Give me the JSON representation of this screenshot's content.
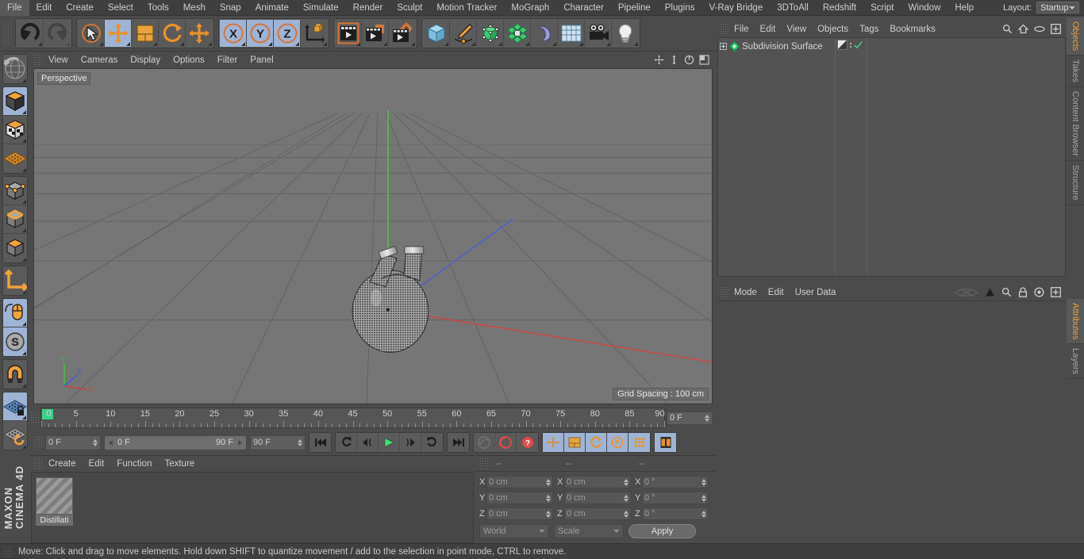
{
  "app": {
    "title": "CINEMA 4D",
    "brand_top": "MAXON",
    "brand_bottom": "CINEMA 4D"
  },
  "menubar": {
    "items": [
      {
        "label": "File"
      },
      {
        "label": "Edit"
      },
      {
        "label": "Create"
      },
      {
        "label": "Select"
      },
      {
        "label": "Tools"
      },
      {
        "label": "Mesh"
      },
      {
        "label": "Snap"
      },
      {
        "label": "Animate"
      },
      {
        "label": "Simulate"
      },
      {
        "label": "Render"
      },
      {
        "label": "Sculpt"
      },
      {
        "label": "Motion Tracker"
      },
      {
        "label": "MoGraph"
      },
      {
        "label": "Character"
      },
      {
        "label": "Pipeline"
      },
      {
        "label": "Plugins"
      },
      {
        "label": "V-Ray Bridge"
      },
      {
        "label": "3DToAll"
      },
      {
        "label": "Redshift"
      },
      {
        "label": "Script"
      },
      {
        "label": "Window"
      },
      {
        "label": "Help"
      }
    ],
    "layout_label": "Layout:",
    "layout_value": "Startup"
  },
  "toolbar": {
    "groups": [
      {
        "name": "history",
        "buttons": [
          {
            "icon": "undo-icon",
            "label": "Undo",
            "active": false,
            "disabled": false
          },
          {
            "icon": "redo-icon",
            "label": "Redo",
            "active": false,
            "disabled": true
          }
        ]
      },
      {
        "name": "transform",
        "buttons": [
          {
            "icon": "select-cursor-icon",
            "label": "Live Selection",
            "active": false,
            "disabled": false
          },
          {
            "icon": "move-icon",
            "label": "Move",
            "active": true,
            "disabled": false
          },
          {
            "icon": "scale-icon",
            "label": "Scale",
            "active": false,
            "disabled": false
          },
          {
            "icon": "rotate-icon",
            "label": "Rotate",
            "active": false,
            "disabled": false
          },
          {
            "icon": "move-alt-icon",
            "label": "Move (duplicate)",
            "active": false,
            "disabled": false
          }
        ]
      },
      {
        "name": "axis-lock",
        "buttons": [
          {
            "icon": "axis-x-icon",
            "label": "X Axis",
            "active": true,
            "disabled": false
          },
          {
            "icon": "axis-y-icon",
            "label": "Y Axis",
            "active": true,
            "disabled": false
          },
          {
            "icon": "axis-z-icon",
            "label": "Z Axis",
            "active": true,
            "disabled": false
          },
          {
            "icon": "world-coordinates-icon",
            "label": "World/Object Coordinates",
            "active": false,
            "disabled": false
          }
        ]
      },
      {
        "name": "render",
        "buttons": [
          {
            "icon": "render-view-icon",
            "label": "Render View",
            "active": false,
            "disabled": false
          },
          {
            "icon": "render-to-picture-viewer-icon",
            "label": "Render to Picture Viewer",
            "active": false,
            "disabled": false
          },
          {
            "icon": "render-settings-icon",
            "label": "Edit Render Settings",
            "active": false,
            "disabled": false
          }
        ]
      },
      {
        "name": "create",
        "buttons": [
          {
            "icon": "cube-primitive-icon",
            "label": "Add Cube Object",
            "active": false,
            "disabled": false
          },
          {
            "icon": "spline-pen-icon",
            "label": "Add Spline",
            "active": false,
            "disabled": false
          },
          {
            "icon": "generator-icon",
            "label": "Add Generator",
            "active": false,
            "disabled": false
          },
          {
            "icon": "deformer-icon",
            "label": "Add Deformer",
            "active": false,
            "disabled": false
          },
          {
            "icon": "bend-icon",
            "label": "Add Bend",
            "active": false,
            "disabled": false
          },
          {
            "icon": "floor-scene-icon",
            "label": "Add Scene Object",
            "active": false,
            "disabled": false
          },
          {
            "icon": "camera-icon",
            "label": "Add Camera",
            "active": false,
            "disabled": false
          },
          {
            "icon": "light-bulb-icon",
            "label": "Add Light",
            "active": false,
            "disabled": false
          }
        ]
      }
    ]
  },
  "leftbar": {
    "groups": [
      {
        "buttons": [
          {
            "icon": "undo-view-globe-icon",
            "label": "Undo View",
            "active": false
          }
        ]
      },
      {
        "buttons": [
          {
            "icon": "model-mode-icon",
            "label": "Model Mode",
            "active": true
          },
          {
            "icon": "texture-mode-icon",
            "label": "Texture Mode",
            "active": false
          },
          {
            "icon": "workplane-mode-icon",
            "label": "Workplane Mode",
            "active": false
          }
        ]
      },
      {
        "buttons": [
          {
            "icon": "point-mode-icon",
            "label": "Points Mode",
            "active": false
          },
          {
            "icon": "edge-mode-icon",
            "label": "Edges Mode",
            "active": false
          },
          {
            "icon": "polygon-mode-icon",
            "label": "Polygons Mode",
            "active": false
          }
        ]
      },
      {
        "buttons": [
          {
            "icon": "axis-modify-icon",
            "label": "Enable Axis Modification",
            "active": false
          }
        ]
      },
      {
        "buttons": [
          {
            "icon": "viewport-solo-mouse-icon",
            "label": "Enable Snapping",
            "active": true
          },
          {
            "icon": "soft-selection-icon",
            "label": "Soft Interaction",
            "active": true
          }
        ]
      },
      {
        "buttons": [
          {
            "icon": "magnet-icon",
            "label": "Magnet",
            "active": false
          }
        ]
      },
      {
        "buttons": [
          {
            "icon": "workplane-lock-icon",
            "label": "Lock Workplane",
            "active": true
          },
          {
            "icon": "workplane-reset-icon",
            "label": "Planar Workplane Mode",
            "active": false
          }
        ]
      }
    ]
  },
  "viewport": {
    "menu": [
      {
        "label": "View"
      },
      {
        "label": "Cameras"
      },
      {
        "label": "Display"
      },
      {
        "label": "Options"
      },
      {
        "label": "Filter"
      },
      {
        "label": "Panel"
      }
    ],
    "icons": [
      {
        "name": "pan-view-icon"
      },
      {
        "name": "dolly-view-icon"
      },
      {
        "name": "rotate-view-icon"
      },
      {
        "name": "maximize-view-icon"
      }
    ],
    "camera_label": "Perspective",
    "grid_spacing": "Grid Spacing : 100 cm",
    "axis_gizmo": {
      "x": "X",
      "y": "Y",
      "z": "Z",
      "x_color": "#d04040",
      "y_color": "#40c040",
      "z_color": "#4060d0"
    },
    "scene_object": "distillation-flask"
  },
  "timeline": {
    "labels": [
      "0",
      "5",
      "10",
      "15",
      "20",
      "25",
      "30",
      "35",
      "40",
      "45",
      "50",
      "55",
      "60",
      "65",
      "70",
      "75",
      "80",
      "85",
      "90"
    ],
    "min_frame": 0,
    "max_frame": 90,
    "current_frame_field": "0 F"
  },
  "playback": {
    "current_frame": "0 F",
    "range_start": "0 F",
    "range_end": "90 F",
    "end_frame": "90 F",
    "transport": [
      {
        "icon": "go-to-start-icon",
        "label": "Go to Start",
        "active": false,
        "disabled": false
      },
      {
        "icon": "step-back-keyframe-icon",
        "label": "Go to Previous Key",
        "active": false,
        "disabled": false
      },
      {
        "icon": "step-back-frame-icon",
        "label": "Go to Previous Frame",
        "active": false,
        "disabled": false
      },
      {
        "icon": "play-icon",
        "label": "Play Forwards",
        "active": false,
        "disabled": false
      },
      {
        "icon": "step-forward-frame-icon",
        "label": "Go to Next Frame",
        "active": false,
        "disabled": false
      },
      {
        "icon": "step-forward-keyframe-icon",
        "label": "Go to Next Key",
        "active": false,
        "disabled": false
      },
      {
        "icon": "go-to-end-icon",
        "label": "Go to End",
        "active": false,
        "disabled": false
      }
    ],
    "record": [
      {
        "icon": "record-key-icon",
        "label": "Record Active Objects",
        "active": false,
        "disabled": true
      },
      {
        "icon": "autokey-icon",
        "label": "Autokeying",
        "active": false,
        "disabled": false
      },
      {
        "icon": "keyframe-question-icon",
        "label": "Keyframe Selection",
        "active": false,
        "disabled": false
      }
    ],
    "keytypes": [
      {
        "icon": "key-position-icon",
        "label": "Position",
        "active": true
      },
      {
        "icon": "key-scale-icon",
        "label": "Scale",
        "active": true
      },
      {
        "icon": "key-rotation-icon",
        "label": "Rotation",
        "active": true
      },
      {
        "icon": "key-parameter-icon",
        "label": "Parameter",
        "active": true
      },
      {
        "icon": "key-pla-icon",
        "label": "Point Level Animation",
        "active": true
      }
    ],
    "timeline_toggle": {
      "icon": "timeline-filmstrip-icon",
      "label": "Show Timeline",
      "active": true
    }
  },
  "material_manager": {
    "menu": [
      {
        "label": "Create"
      },
      {
        "label": "Edit"
      },
      {
        "label": "Function"
      },
      {
        "label": "Texture"
      }
    ],
    "materials": [
      {
        "name": "Distillati",
        "swatch": "diagonal-stripes"
      }
    ]
  },
  "coordinates": {
    "headers": [
      "--",
      "--",
      "--"
    ],
    "rows": [
      {
        "axis": "X",
        "position": "0 cm",
        "size": "0 cm",
        "rotation": "0 °"
      },
      {
        "axis": "Y",
        "position": "0 cm",
        "size": "0 cm",
        "rotation": "0 °"
      },
      {
        "axis": "Z",
        "position": "0 cm",
        "size": "0 cm",
        "rotation": "0 °"
      }
    ],
    "system": "World",
    "mode": "Scale",
    "apply_label": "Apply"
  },
  "object_manager": {
    "menu": [
      {
        "label": "File"
      },
      {
        "label": "Edit"
      },
      {
        "label": "View"
      },
      {
        "label": "Objects"
      },
      {
        "label": "Tags"
      },
      {
        "label": "Bookmarks"
      }
    ],
    "icons": [
      {
        "name": "search-icon"
      },
      {
        "name": "home-icon"
      },
      {
        "name": "ellipse-icon"
      },
      {
        "name": "add-panel-icon"
      }
    ],
    "objects": [
      {
        "name": "Subdivision Surface",
        "icon": "subdivision-surface-icon",
        "icon_color": "#3ed07e",
        "expandable": true,
        "tags": [
          "material-tag",
          "visibility-dots",
          "check-tag"
        ]
      }
    ]
  },
  "attribute_manager": {
    "menu": [
      {
        "label": "Mode"
      },
      {
        "label": "Edit"
      },
      {
        "label": "User Data"
      }
    ],
    "icons": [
      {
        "name": "layer-stack-icon"
      },
      {
        "name": "up-arrow-icon"
      },
      {
        "name": "search-icon"
      },
      {
        "name": "lock-icon"
      },
      {
        "name": "target-icon"
      },
      {
        "name": "add-panel-icon"
      }
    ]
  },
  "vertical_tabs": [
    {
      "label": "Objects",
      "active": true
    },
    {
      "label": "Takes",
      "active": false
    },
    {
      "label": "Content Browser",
      "active": false
    },
    {
      "label": "Structure",
      "active": false
    },
    {
      "label": "Attributes",
      "active": true
    },
    {
      "label": "Layers",
      "active": false
    }
  ],
  "statusbar": {
    "message": "Move: Click and drag to move elements. Hold down SHIFT to quantize movement / add to the selection in point mode, CTRL to remove."
  },
  "colors": {
    "accent_orange": "#f0a030",
    "active_blue": "#9fb4d4",
    "panel_bg": "#4b4b4b",
    "viewport_bg": "#767676",
    "axis_x": "#d04040",
    "axis_y": "#40c040",
    "axis_z": "#4060d0"
  }
}
